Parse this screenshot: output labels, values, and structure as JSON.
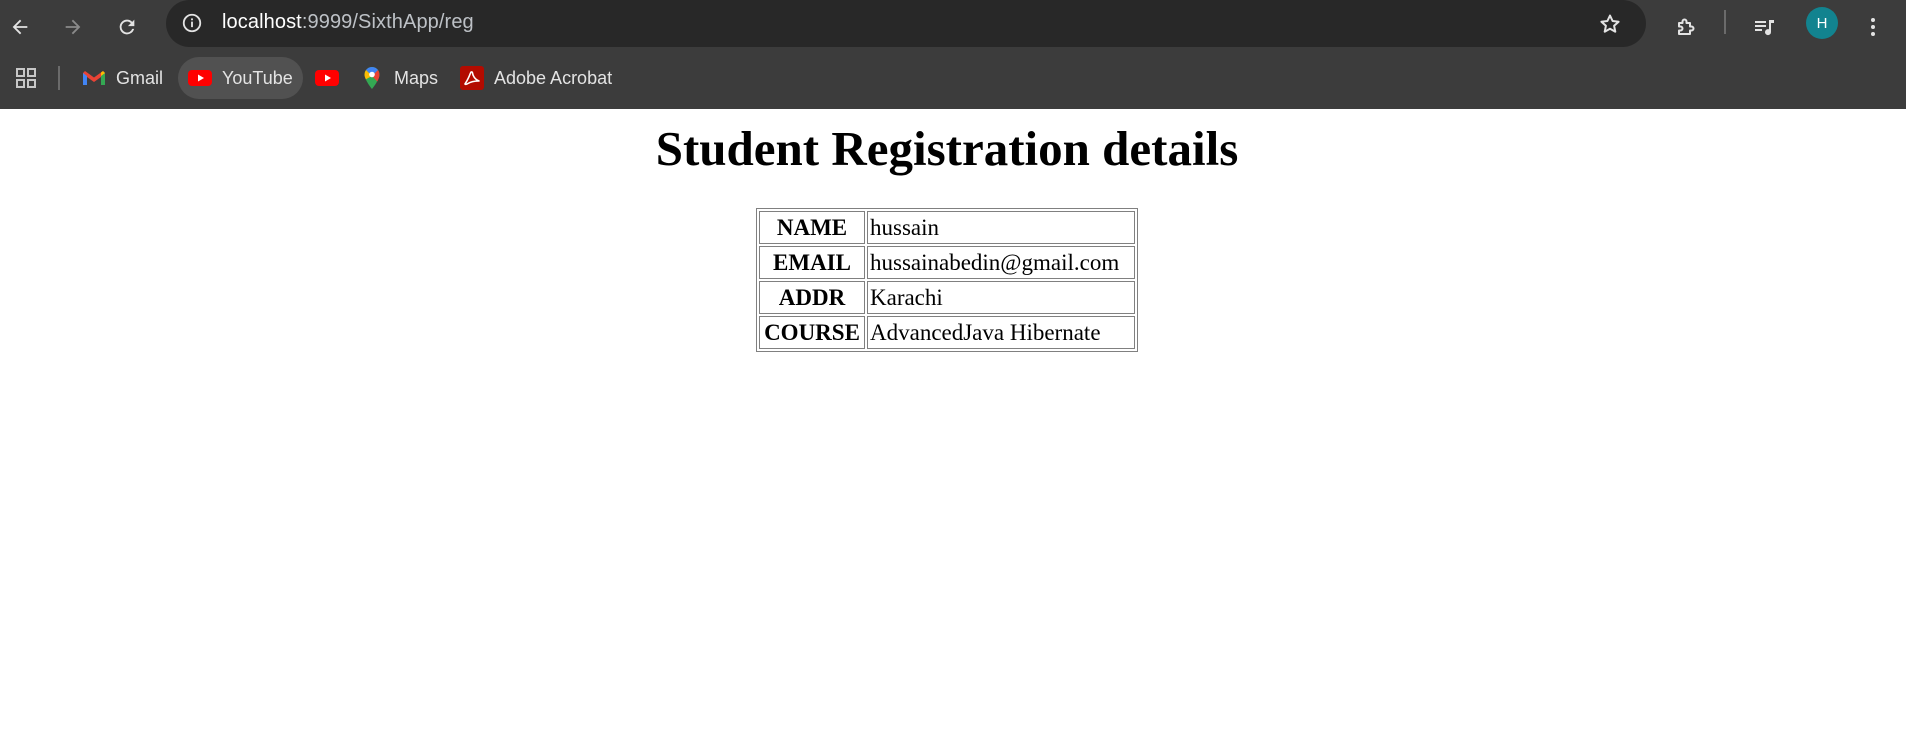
{
  "browser": {
    "url_host": "localhost",
    "url_path": ":9999/SixthApp/reg",
    "profile_initial": "H",
    "icons": {
      "back": "arrow-left-icon",
      "forward": "arrow-right-icon",
      "reload": "reload-icon",
      "site_info": "info-icon",
      "bookmark_star": "star-icon",
      "extensions": "puzzle-icon",
      "media": "media-queue-icon",
      "menu": "kebab-menu-icon"
    },
    "colors": {
      "chrome_bg": "#3c3c3c",
      "omnibox_bg": "#282828",
      "avatar_bg": "#12838f"
    }
  },
  "bookmarks": {
    "items": [
      {
        "label": "Gmail",
        "icon": "gmail-icon"
      },
      {
        "label": "YouTube",
        "icon": "youtube-icon"
      },
      {
        "label": "",
        "icon": "youtube-icon"
      },
      {
        "label": "Maps",
        "icon": "maps-pin-icon"
      },
      {
        "label": "Adobe Acrobat",
        "icon": "adobe-acrobat-icon"
      }
    ]
  },
  "page": {
    "title": "Student Registration details",
    "rows": [
      {
        "label": "NAME",
        "value": "hussain"
      },
      {
        "label": "EMAIL",
        "value": "hussainabedin@gmail.com"
      },
      {
        "label": "ADDR",
        "value": "Karachi"
      },
      {
        "label": "COURSE",
        "value": "AdvancedJava Hibernate"
      }
    ]
  }
}
